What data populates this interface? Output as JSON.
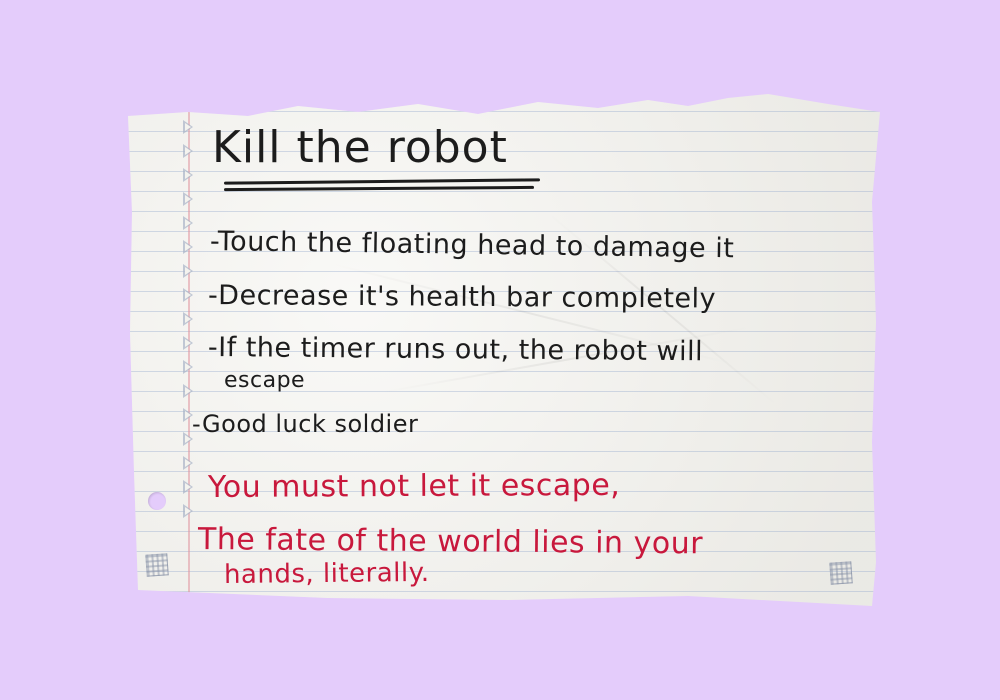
{
  "note": {
    "title": "Kill the robot",
    "instructions": [
      "-Touch the floating head to damage it",
      "-Decrease it's health bar completely",
      "-If the timer runs out, the robot will",
      "escape",
      "-Good luck soldier"
    ],
    "warning_lines": [
      "You must not let it escape,",
      "The fate of the world lies in your",
      "hands, literally."
    ]
  },
  "colors": {
    "background": "#e4ccfb",
    "paper": "#f4f3ee",
    "black_ink": "#1c1c1c",
    "red_ink": "#c8183c",
    "ruled_line": "#96aacd",
    "margin_line": "#e096a0"
  }
}
